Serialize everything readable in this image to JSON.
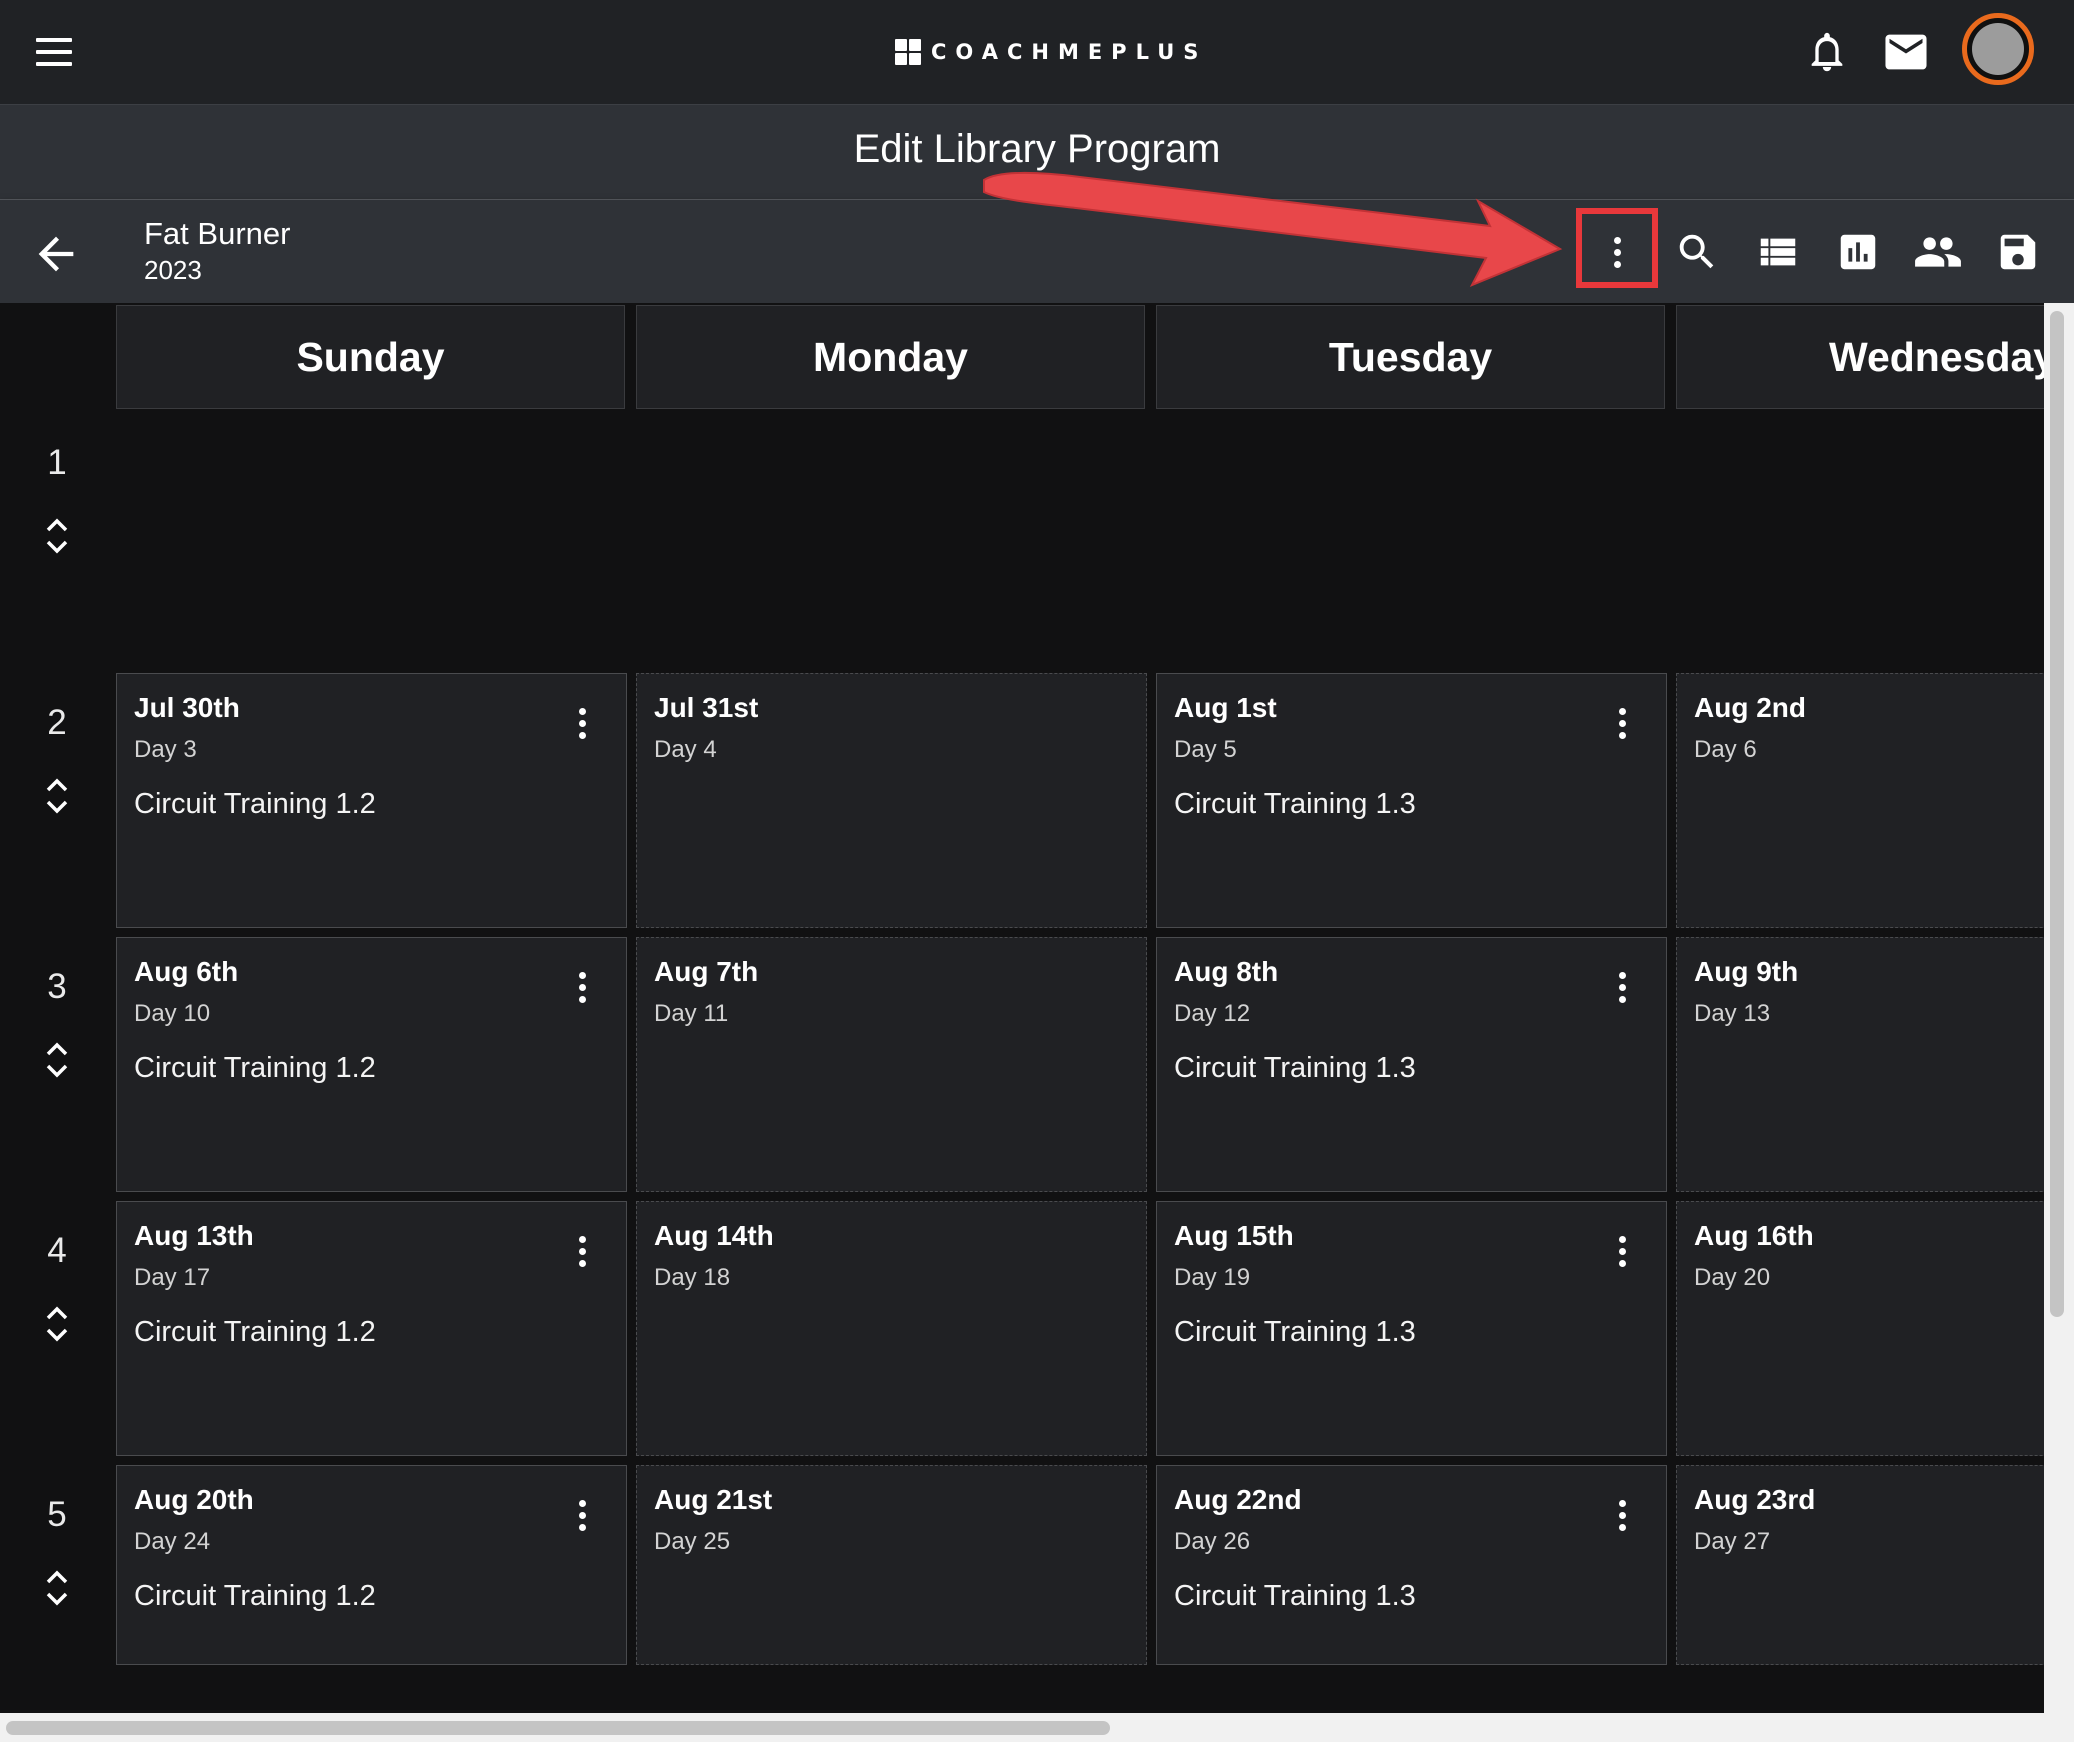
{
  "header": {
    "brand_text": "COACHMEPLUS",
    "icons": [
      "menu-icon",
      "bell-icon",
      "mail-icon",
      "avatar"
    ]
  },
  "page": {
    "title": "Edit Library Program"
  },
  "program": {
    "name": "Fat Burner",
    "year": "2023",
    "toolbar_icons": [
      "back-arrow-icon",
      "more-vert-icon",
      "search-icon",
      "list-icon",
      "bar-chart-icon",
      "people-icon",
      "save-icon"
    ]
  },
  "annotation": {
    "color": "#e8383b",
    "target": "more-vert-icon"
  },
  "calendar": {
    "days": [
      "Sunday",
      "Monday",
      "Tuesday",
      "Wednesday"
    ],
    "weeks": [
      {
        "number": "1",
        "cells": []
      },
      {
        "number": "2",
        "cells": [
          {
            "date": "Jul 30th",
            "day": "Day 3",
            "workout": "Circuit Training 1.2"
          },
          {
            "date": "Jul 31st",
            "day": "Day 4",
            "workout": ""
          },
          {
            "date": "Aug 1st",
            "day": "Day 5",
            "workout": "Circuit Training 1.3"
          },
          {
            "date": "Aug 2nd",
            "day": "Day 6",
            "workout": ""
          }
        ]
      },
      {
        "number": "3",
        "cells": [
          {
            "date": "Aug 6th",
            "day": "Day 10",
            "workout": "Circuit Training 1.2"
          },
          {
            "date": "Aug 7th",
            "day": "Day 11",
            "workout": ""
          },
          {
            "date": "Aug 8th",
            "day": "Day 12",
            "workout": "Circuit Training 1.3"
          },
          {
            "date": "Aug 9th",
            "day": "Day 13",
            "workout": ""
          }
        ]
      },
      {
        "number": "4",
        "cells": [
          {
            "date": "Aug 13th",
            "day": "Day 17",
            "workout": "Circuit Training 1.2"
          },
          {
            "date": "Aug 14th",
            "day": "Day 18",
            "workout": ""
          },
          {
            "date": "Aug 15th",
            "day": "Day 19",
            "workout": "Circuit Training 1.3"
          },
          {
            "date": "Aug 16th",
            "day": "Day 20",
            "workout": ""
          }
        ]
      },
      {
        "number": "5",
        "cells": [
          {
            "date": "Aug 20th",
            "day": "Day 24",
            "workout": "Circuit Training 1.2"
          },
          {
            "date": "Aug 21st",
            "day": "Day 25",
            "workout": ""
          },
          {
            "date": "Aug 22nd",
            "day": "Day 26",
            "workout": "Circuit Training 1.3"
          },
          {
            "date": "Aug 23rd",
            "day": "Day 27",
            "workout": ""
          }
        ]
      }
    ]
  }
}
